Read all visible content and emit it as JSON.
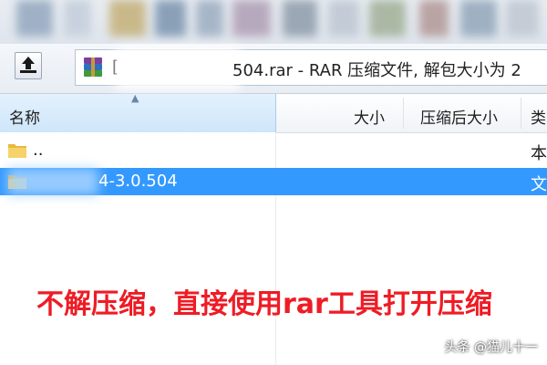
{
  "window": {
    "address_prefix": "[",
    "address_title": "504.rar - RAR 压缩文件, 解包大小为 2"
  },
  "columns": {
    "name": "名称",
    "size": "大小",
    "packed_size": "压缩后大小",
    "type": "类"
  },
  "rows": [
    {
      "name": "..",
      "type": "本",
      "icon": "folder-icon",
      "selected": false
    },
    {
      "name": "4-3.0.504",
      "type": "文",
      "icon": "folder-icon",
      "selected": true
    }
  ],
  "annotation": "不解压缩，直接使用rar工具打开压缩",
  "watermark": "头条 @猫儿十一",
  "colors": {
    "selection": "#3399ff",
    "annotation": "#ee1c25",
    "header_active": "#cfe6fa"
  }
}
